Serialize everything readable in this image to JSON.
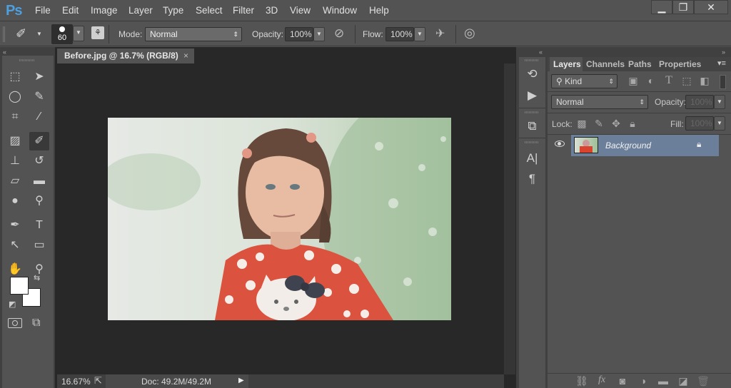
{
  "app": {
    "logo": "Ps"
  },
  "menu": [
    "File",
    "Edit",
    "Image",
    "Layer",
    "Type",
    "Select",
    "Filter",
    "3D",
    "View",
    "Window",
    "Help"
  ],
  "window_controls": {
    "minimize": "▁",
    "restore": "❐",
    "close": "✕"
  },
  "options_bar": {
    "brush_size": "60",
    "mode_label": "Mode:",
    "mode_value": "Normal",
    "opacity_label": "Opacity:",
    "opacity_value": "100%",
    "flow_label": "Flow:",
    "flow_value": "100%"
  },
  "document": {
    "tab_title": "Before.jpg @ 16.7% (RGB/8)",
    "tab_close": "×",
    "zoom": "16.67%",
    "doc_info": "Doc: 49.2M/49.2M"
  },
  "tools": [
    {
      "name": "rectangular-marquee-tool",
      "glyph": "⬚"
    },
    {
      "name": "move-tool",
      "glyph": "➤"
    },
    {
      "name": "lasso-tool",
      "glyph": "◯"
    },
    {
      "name": "quick-selection-tool",
      "glyph": "✎"
    },
    {
      "name": "crop-tool",
      "glyph": "⌗"
    },
    {
      "name": "eyedropper-tool",
      "glyph": "⁄"
    },
    {
      "name": "spot-healing-brush-tool",
      "glyph": "▨"
    },
    {
      "name": "brush-tool",
      "glyph": "✐"
    },
    {
      "name": "clone-stamp-tool",
      "glyph": "⊥"
    },
    {
      "name": "history-brush-tool",
      "glyph": "↺"
    },
    {
      "name": "eraser-tool",
      "glyph": "▱"
    },
    {
      "name": "gradient-tool",
      "glyph": "▬"
    },
    {
      "name": "blur-tool",
      "glyph": "●"
    },
    {
      "name": "dodge-tool",
      "glyph": "⚲"
    },
    {
      "name": "pen-tool",
      "glyph": "✒"
    },
    {
      "name": "type-tool",
      "glyph": "T"
    },
    {
      "name": "path-selection-tool",
      "glyph": "↖"
    },
    {
      "name": "rectangle-tool",
      "glyph": "▭"
    },
    {
      "name": "hand-tool",
      "glyph": "✋"
    },
    {
      "name": "zoom-tool",
      "glyph": "⚲"
    }
  ],
  "colors": {
    "foreground": "#ffffff",
    "background": "#ffffff",
    "layer_selected": "#6b7f9b",
    "accent": "#4d9fe0"
  },
  "dock_icons": [
    {
      "name": "history-icon",
      "glyph": "⟲"
    },
    {
      "name": "actions-play-icon",
      "glyph": "▶"
    },
    {
      "name": "clone-source-icon",
      "glyph": "⧉"
    },
    {
      "name": "character-icon",
      "glyph": "A|"
    },
    {
      "name": "paragraph-icon",
      "glyph": "¶"
    }
  ],
  "layers_panel": {
    "tabs": [
      "Layers",
      "Channels",
      "Paths",
      "Properties"
    ],
    "filter_kind": "Kind",
    "blend_mode": "Normal",
    "opacity_label": "Opacity:",
    "opacity_value": "100%",
    "lock_label": "Lock:",
    "fill_label": "Fill:",
    "fill_value": "100%",
    "layers": [
      {
        "name": "Background",
        "visible": true,
        "locked": true
      }
    ]
  }
}
